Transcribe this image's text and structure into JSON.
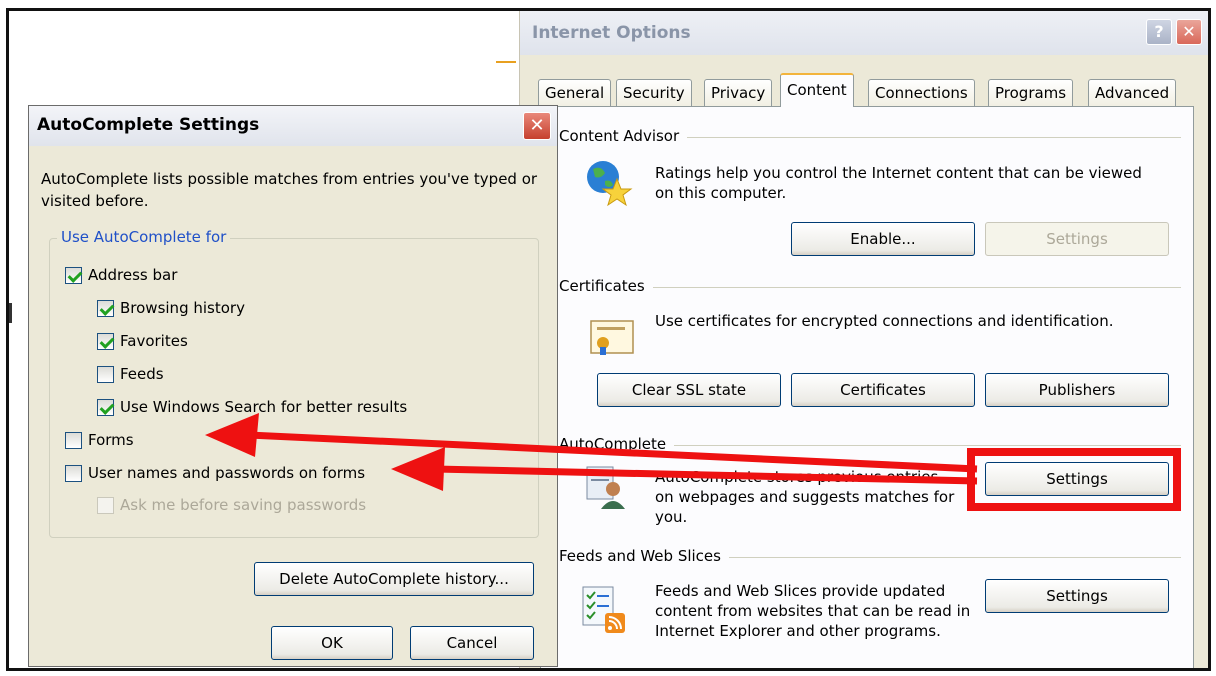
{
  "internet_options": {
    "title": "Internet Options",
    "help_button": "?",
    "close_button": "✕",
    "tabs": [
      "General",
      "Security",
      "Privacy",
      "Content",
      "Connections",
      "Programs",
      "Advanced"
    ],
    "active_tab": "Content",
    "content_advisor": {
      "label": "Content Advisor",
      "description": "Ratings help you control the Internet content that can be viewed on this computer.",
      "enable_button": "Enable...",
      "settings_button": "Settings"
    },
    "certificates": {
      "label": "Certificates",
      "description": "Use certificates for encrypted connections and identification.",
      "clear_ssl_button": "Clear SSL state",
      "certificates_button": "Certificates",
      "publishers_button": "Publishers"
    },
    "autocomplete": {
      "label": "AutoComplete",
      "description": "AutoComplete stores previous entries on webpages and suggests matches for you.",
      "settings_button": "Settings"
    },
    "feeds": {
      "label": "Feeds and Web Slices",
      "description": "Feeds and Web Slices provide updated content from websites that can be read in Internet Explorer and other programs.",
      "settings_button": "Settings"
    }
  },
  "autocomplete_dialog": {
    "title": "AutoComplete Settings",
    "close_button": "✕",
    "description": "AutoComplete lists possible matches from entries you've typed or visited before.",
    "group_label": "Use AutoComplete for",
    "options": {
      "address_bar": {
        "label": "Address bar",
        "checked": true
      },
      "browsing_history": {
        "label": "Browsing history",
        "checked": true
      },
      "favorites": {
        "label": "Favorites",
        "checked": true
      },
      "feeds": {
        "label": "Feeds",
        "checked": false
      },
      "windows_search": {
        "label": "Use Windows Search for better results",
        "checked": true
      },
      "forms": {
        "label": "Forms",
        "checked": false
      },
      "usernames_passwords": {
        "label": "User names and passwords on forms",
        "checked": false
      },
      "ask_before_saving": {
        "label": "Ask me before saving passwords",
        "checked": false,
        "disabled": true
      }
    },
    "delete_history_button": "Delete AutoComplete history...",
    "ok_button": "OK",
    "cancel_button": "Cancel"
  },
  "annotation_colors": {
    "arrow": "#ee1111",
    "highlight": "#ee1111"
  }
}
